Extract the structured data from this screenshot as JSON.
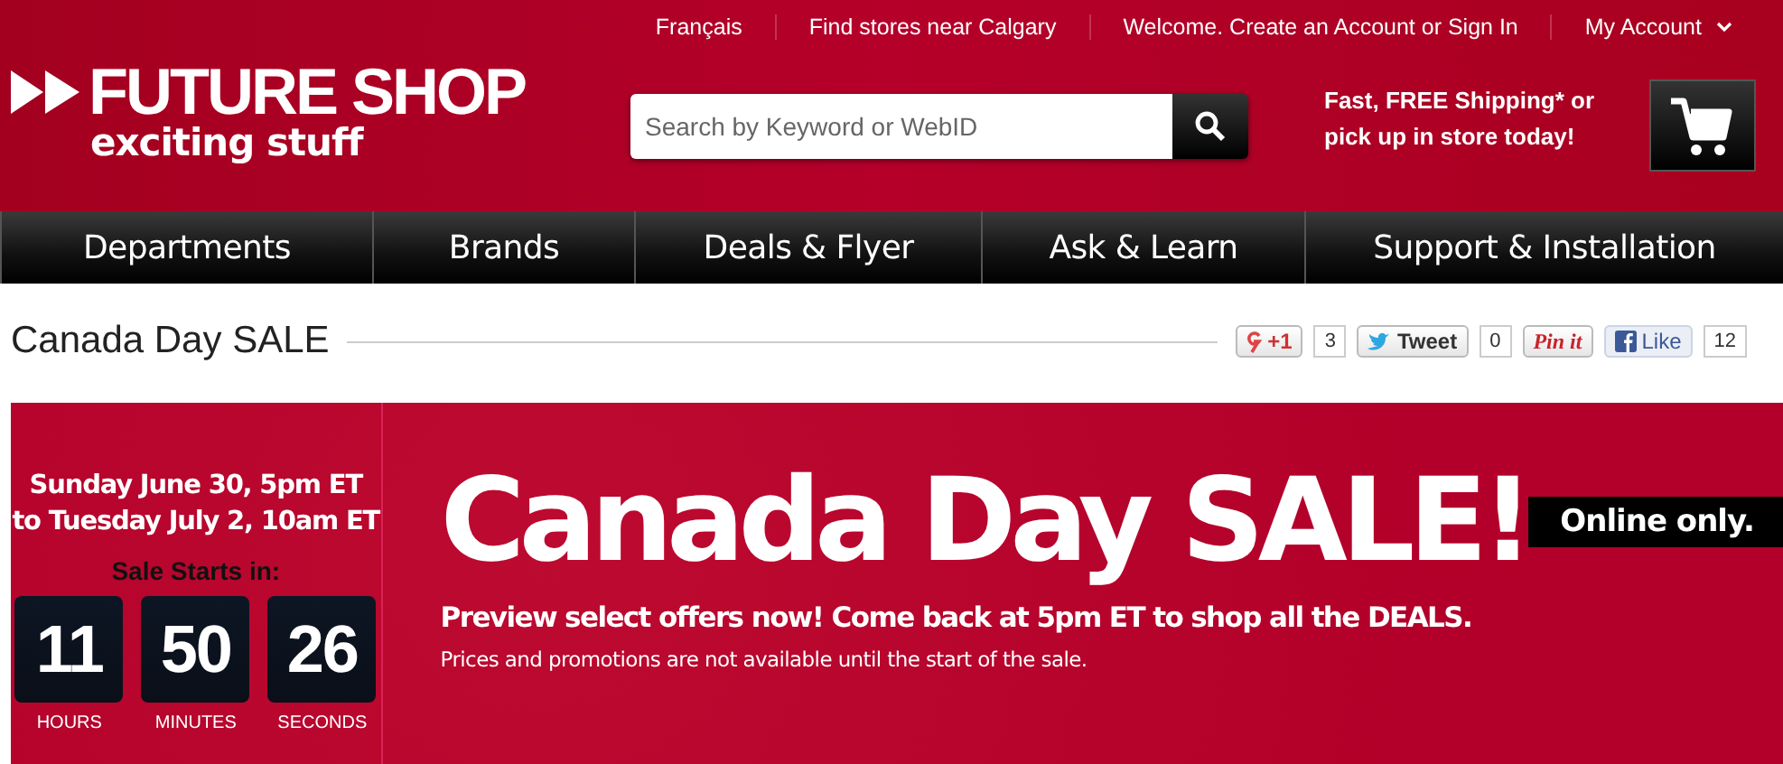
{
  "top_links": [
    {
      "label": "Français"
    },
    {
      "label": "Find stores near Calgary"
    },
    {
      "label": "Welcome. Create an Account or Sign In"
    },
    {
      "label": "My Account",
      "kind": "dropdown"
    }
  ],
  "logo": {
    "name": "FUTURE SHOP",
    "tagline": "exciting stuff"
  },
  "search": {
    "placeholder": "Search by Keyword or WebID"
  },
  "shipping_promo": [
    "Fast, FREE Shipping* or",
    "pick up in store today!"
  ],
  "nav": [
    "Departments",
    "Brands",
    "Deals & Flyer",
    "Ask & Learn",
    "Support & Installation"
  ],
  "page_title": "Canada Day SALE",
  "social": [
    {
      "kind": "gplus",
      "label": "+1",
      "count": "3"
    },
    {
      "kind": "twitter",
      "label": "Tweet",
      "count": "0"
    },
    {
      "kind": "pinterest",
      "label": "Pin it"
    },
    {
      "kind": "facebook",
      "label": "Like",
      "count": "12"
    }
  ],
  "banner": {
    "dates": [
      "Sunday June 30, 5pm ET",
      "to Tuesday July 2, 10am ET"
    ],
    "countdown_label": "Sale Starts in:",
    "countdown": [
      {
        "value": "11",
        "unit": "HOURS"
      },
      {
        "value": "50",
        "unit": "MINUTES"
      },
      {
        "value": "26",
        "unit": "SECONDS"
      }
    ],
    "headline": "Canada Day SALE!",
    "badge": "Online only.",
    "subhead": "Preview select offers now! Come back at 5pm ET to shop all the DEALS.",
    "note": "Prices and promotions are not available until the start of the sale."
  }
}
